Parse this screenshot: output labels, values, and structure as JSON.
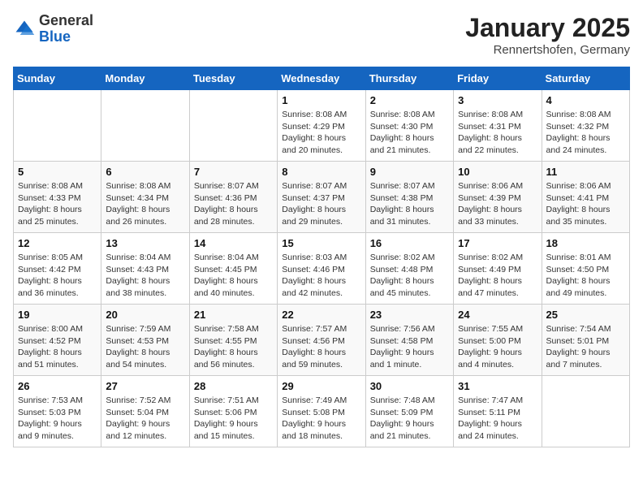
{
  "header": {
    "logo_general": "General",
    "logo_blue": "Blue",
    "month": "January 2025",
    "location": "Rennertshofen, Germany"
  },
  "weekdays": [
    "Sunday",
    "Monday",
    "Tuesday",
    "Wednesday",
    "Thursday",
    "Friday",
    "Saturday"
  ],
  "weeks": [
    [
      {
        "day": "",
        "info": ""
      },
      {
        "day": "",
        "info": ""
      },
      {
        "day": "",
        "info": ""
      },
      {
        "day": "1",
        "info": "Sunrise: 8:08 AM\nSunset: 4:29 PM\nDaylight: 8 hours\nand 20 minutes."
      },
      {
        "day": "2",
        "info": "Sunrise: 8:08 AM\nSunset: 4:30 PM\nDaylight: 8 hours\nand 21 minutes."
      },
      {
        "day": "3",
        "info": "Sunrise: 8:08 AM\nSunset: 4:31 PM\nDaylight: 8 hours\nand 22 minutes."
      },
      {
        "day": "4",
        "info": "Sunrise: 8:08 AM\nSunset: 4:32 PM\nDaylight: 8 hours\nand 24 minutes."
      }
    ],
    [
      {
        "day": "5",
        "info": "Sunrise: 8:08 AM\nSunset: 4:33 PM\nDaylight: 8 hours\nand 25 minutes."
      },
      {
        "day": "6",
        "info": "Sunrise: 8:08 AM\nSunset: 4:34 PM\nDaylight: 8 hours\nand 26 minutes."
      },
      {
        "day": "7",
        "info": "Sunrise: 8:07 AM\nSunset: 4:36 PM\nDaylight: 8 hours\nand 28 minutes."
      },
      {
        "day": "8",
        "info": "Sunrise: 8:07 AM\nSunset: 4:37 PM\nDaylight: 8 hours\nand 29 minutes."
      },
      {
        "day": "9",
        "info": "Sunrise: 8:07 AM\nSunset: 4:38 PM\nDaylight: 8 hours\nand 31 minutes."
      },
      {
        "day": "10",
        "info": "Sunrise: 8:06 AM\nSunset: 4:39 PM\nDaylight: 8 hours\nand 33 minutes."
      },
      {
        "day": "11",
        "info": "Sunrise: 8:06 AM\nSunset: 4:41 PM\nDaylight: 8 hours\nand 35 minutes."
      }
    ],
    [
      {
        "day": "12",
        "info": "Sunrise: 8:05 AM\nSunset: 4:42 PM\nDaylight: 8 hours\nand 36 minutes."
      },
      {
        "day": "13",
        "info": "Sunrise: 8:04 AM\nSunset: 4:43 PM\nDaylight: 8 hours\nand 38 minutes."
      },
      {
        "day": "14",
        "info": "Sunrise: 8:04 AM\nSunset: 4:45 PM\nDaylight: 8 hours\nand 40 minutes."
      },
      {
        "day": "15",
        "info": "Sunrise: 8:03 AM\nSunset: 4:46 PM\nDaylight: 8 hours\nand 42 minutes."
      },
      {
        "day": "16",
        "info": "Sunrise: 8:02 AM\nSunset: 4:48 PM\nDaylight: 8 hours\nand 45 minutes."
      },
      {
        "day": "17",
        "info": "Sunrise: 8:02 AM\nSunset: 4:49 PM\nDaylight: 8 hours\nand 47 minutes."
      },
      {
        "day": "18",
        "info": "Sunrise: 8:01 AM\nSunset: 4:50 PM\nDaylight: 8 hours\nand 49 minutes."
      }
    ],
    [
      {
        "day": "19",
        "info": "Sunrise: 8:00 AM\nSunset: 4:52 PM\nDaylight: 8 hours\nand 51 minutes."
      },
      {
        "day": "20",
        "info": "Sunrise: 7:59 AM\nSunset: 4:53 PM\nDaylight: 8 hours\nand 54 minutes."
      },
      {
        "day": "21",
        "info": "Sunrise: 7:58 AM\nSunset: 4:55 PM\nDaylight: 8 hours\nand 56 minutes."
      },
      {
        "day": "22",
        "info": "Sunrise: 7:57 AM\nSunset: 4:56 PM\nDaylight: 8 hours\nand 59 minutes."
      },
      {
        "day": "23",
        "info": "Sunrise: 7:56 AM\nSunset: 4:58 PM\nDaylight: 9 hours\nand 1 minute."
      },
      {
        "day": "24",
        "info": "Sunrise: 7:55 AM\nSunset: 5:00 PM\nDaylight: 9 hours\nand 4 minutes."
      },
      {
        "day": "25",
        "info": "Sunrise: 7:54 AM\nSunset: 5:01 PM\nDaylight: 9 hours\nand 7 minutes."
      }
    ],
    [
      {
        "day": "26",
        "info": "Sunrise: 7:53 AM\nSunset: 5:03 PM\nDaylight: 9 hours\nand 9 minutes."
      },
      {
        "day": "27",
        "info": "Sunrise: 7:52 AM\nSunset: 5:04 PM\nDaylight: 9 hours\nand 12 minutes."
      },
      {
        "day": "28",
        "info": "Sunrise: 7:51 AM\nSunset: 5:06 PM\nDaylight: 9 hours\nand 15 minutes."
      },
      {
        "day": "29",
        "info": "Sunrise: 7:49 AM\nSunset: 5:08 PM\nDaylight: 9 hours\nand 18 minutes."
      },
      {
        "day": "30",
        "info": "Sunrise: 7:48 AM\nSunset: 5:09 PM\nDaylight: 9 hours\nand 21 minutes."
      },
      {
        "day": "31",
        "info": "Sunrise: 7:47 AM\nSunset: 5:11 PM\nDaylight: 9 hours\nand 24 minutes."
      },
      {
        "day": "",
        "info": ""
      }
    ]
  ]
}
